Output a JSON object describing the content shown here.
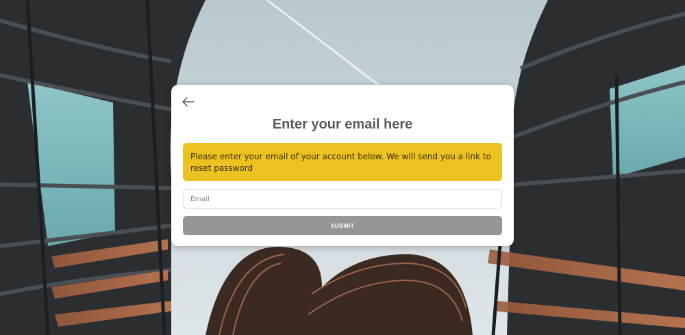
{
  "background": {
    "description_icon": "architecture-photo",
    "sky_color": "#c9d6dc"
  },
  "card": {
    "back_icon": "arrow-left-icon",
    "title": "Enter your email here",
    "notice": "Please enter your email of your account below. We will send you a link to reset password",
    "email_placeholder": "Email",
    "email_value": "",
    "submit_label": "SUBMIT"
  },
  "colors": {
    "notice_bg": "#ecc220",
    "submit_bg": "#969696",
    "title_color": "#5a5a5a"
  }
}
